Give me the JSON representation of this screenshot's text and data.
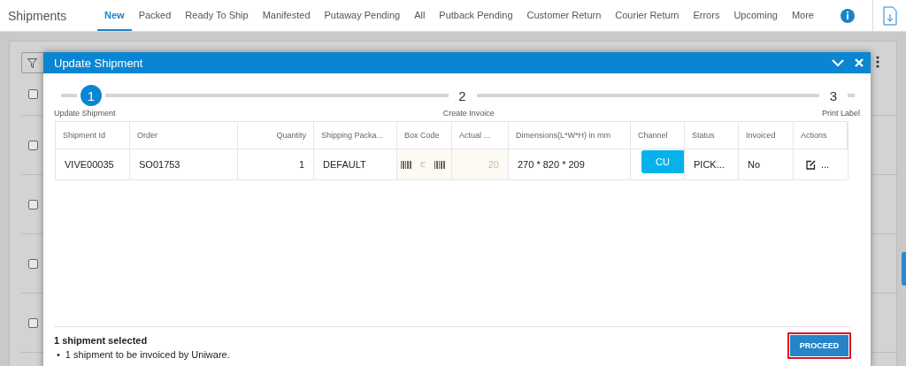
{
  "app_title": "Shipments",
  "tabs": [
    {
      "label": "New",
      "selected": true
    },
    {
      "label": "Packed",
      "selected": false
    },
    {
      "label": "Ready To Ship",
      "selected": false
    },
    {
      "label": "Manifested",
      "selected": false
    },
    {
      "label": "Putaway Pending",
      "selected": false
    },
    {
      "label": "All",
      "selected": false
    },
    {
      "label": "Putback Pending",
      "selected": false
    },
    {
      "label": "Customer Return",
      "selected": false
    },
    {
      "label": "Courier Return",
      "selected": false
    },
    {
      "label": "Errors",
      "selected": false
    },
    {
      "label": "Upcoming",
      "selected": false
    },
    {
      "label": "More",
      "selected": false
    }
  ],
  "background_rows": [
    {
      "checked": false
    },
    {
      "checked": false
    },
    {
      "checked": false
    },
    {
      "checked": false
    },
    {
      "checked": false
    }
  ],
  "dialog": {
    "title": "Update Shipment",
    "steps": [
      {
        "number": "1",
        "label": "Update Shipment",
        "selected": true
      },
      {
        "number": "2",
        "label": "Create Invoice",
        "selected": false
      },
      {
        "number": "3",
        "label": "Print Label",
        "selected": false
      }
    ],
    "table": {
      "columns": [
        "Shipment Id",
        "Order",
        "Quantity",
        "Shipping Packa...",
        "Box Code",
        "Actual ...",
        "Dimensions(L*W*H) in mm",
        "Channel",
        "Status",
        "Invoiced",
        "Actions"
      ],
      "rows": [
        {
          "shipment_id": "VIVE00035",
          "order": "SO01753",
          "quantity": "1",
          "shipping_package": "DEFAULT",
          "box_code": "E",
          "actual": "20",
          "dimensions": "270 * 820 * 209",
          "channel": "CU",
          "status": "PICK...",
          "invoiced": "No",
          "more": "..."
        }
      ]
    },
    "summary": "1 shipment selected",
    "notes": [
      {
        "bullet": "•",
        "text": "1 shipment to be invoiced by Uniware."
      }
    ],
    "proceed_button": "PROCEED"
  }
}
